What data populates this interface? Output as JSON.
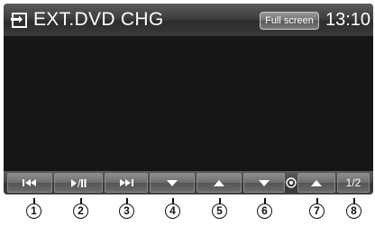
{
  "header": {
    "source_icon": "source-input-icon",
    "title": "EXT.DVD CHG",
    "fullscreen_label": "Full screen",
    "clock": "13:10"
  },
  "controls": {
    "prev_icon": "skip-previous-icon",
    "playpause_icon": "play-pause-icon",
    "next_icon": "skip-next-icon",
    "disc_down_icon": "triangle-down-icon",
    "disc_up_icon": "triangle-up-icon",
    "folder_down_icon": "triangle-down-icon",
    "folder_center_icon": "disc-icon",
    "folder_up_icon": "triangle-up-icon",
    "page_label": "1/2"
  },
  "callouts": [
    "1",
    "2",
    "3",
    "4",
    "5",
    "6",
    "7",
    "8"
  ],
  "colors": {
    "screen_bg": "#171717",
    "bar_gradient_top": "#5e5e5e",
    "button_face": "#6c6c6c",
    "text": "#ffffff"
  }
}
